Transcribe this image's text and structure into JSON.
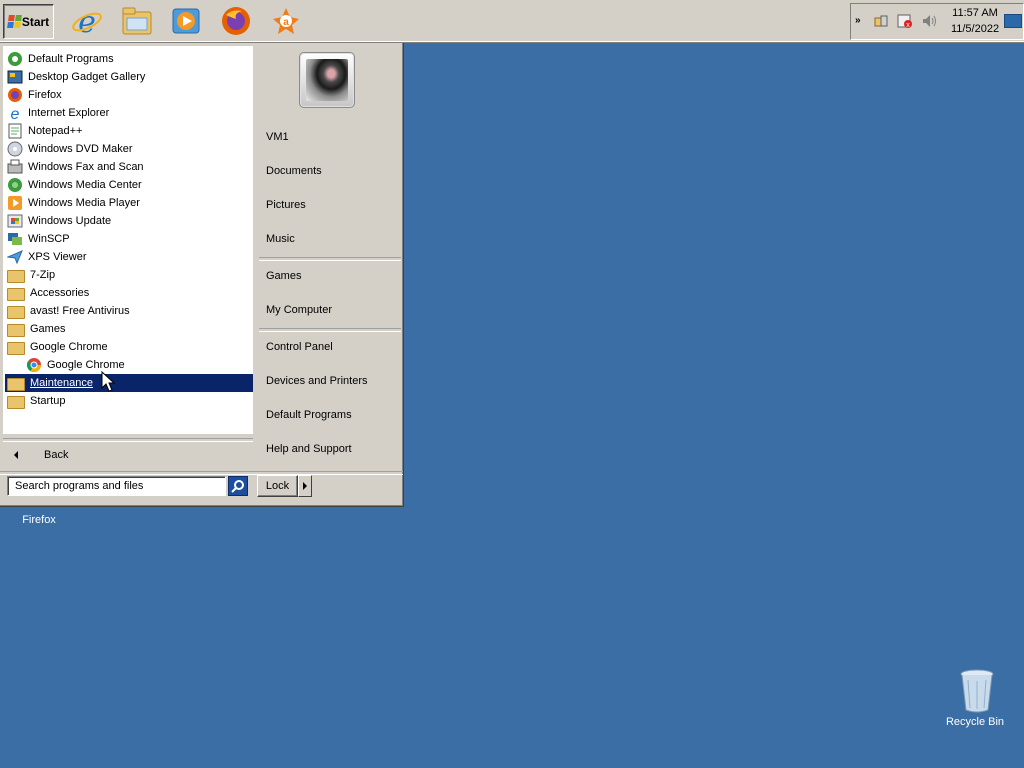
{
  "taskbar": {
    "start_label": "Start",
    "quick_launch": [
      {
        "name": "internet-explorer-icon",
        "color": "#1e73c9"
      },
      {
        "name": "file-explorer-icon",
        "color": "#e9c46a"
      },
      {
        "name": "media-player-icon",
        "color": "#e07b22"
      },
      {
        "name": "firefox-icon",
        "color": "#e66000"
      },
      {
        "name": "avast-icon",
        "color": "#f07c1a"
      }
    ],
    "clock": {
      "time": "11:57 AM",
      "date": "11/5/2022"
    }
  },
  "start_menu": {
    "programs": [
      {
        "label": "Default Programs",
        "icon": "default-programs-icon"
      },
      {
        "label": "Desktop Gadget Gallery",
        "icon": "gadget-gallery-icon"
      },
      {
        "label": "Firefox",
        "icon": "firefox-icon"
      },
      {
        "label": "Internet Explorer",
        "icon": "internet-explorer-icon"
      },
      {
        "label": "Notepad++",
        "icon": "notepad-plus-plus-icon"
      },
      {
        "label": "Windows DVD Maker",
        "icon": "dvd-maker-icon"
      },
      {
        "label": "Windows Fax and Scan",
        "icon": "fax-scan-icon"
      },
      {
        "label": "Windows Media Center",
        "icon": "media-center-icon"
      },
      {
        "label": "Windows Media Player",
        "icon": "media-player-icon"
      },
      {
        "label": "Windows Update",
        "icon": "windows-update-icon"
      },
      {
        "label": "WinSCP",
        "icon": "winscp-icon"
      },
      {
        "label": "XPS Viewer",
        "icon": "xps-viewer-icon"
      },
      {
        "label": "7-Zip",
        "icon": "folder-icon"
      },
      {
        "label": "Accessories",
        "icon": "folder-icon"
      },
      {
        "label": "avast! Free Antivirus",
        "icon": "folder-icon"
      },
      {
        "label": "Games",
        "icon": "folder-icon"
      },
      {
        "label": "Google Chrome",
        "icon": "folder-icon"
      },
      {
        "label": "Google Chrome",
        "icon": "chrome-icon",
        "sub": true
      },
      {
        "label": "Maintenance",
        "icon": "folder-icon",
        "selected": true
      },
      {
        "label": "Startup",
        "icon": "folder-icon"
      }
    ],
    "back_label": "Back",
    "search_placeholder": "Search programs and files",
    "lock_label": "Lock",
    "places_group1": [
      "VM1",
      "Documents",
      "Pictures",
      "Music"
    ],
    "places_group2": [
      "Games",
      "My Computer"
    ],
    "places_group3": [
      "Control Panel",
      "Devices and Printers",
      "Default Programs",
      "Help and Support"
    ]
  },
  "desktop": {
    "firefox_label": "Firefox",
    "recycle_label": "Recycle Bin",
    "background": "#3a6ea5"
  }
}
